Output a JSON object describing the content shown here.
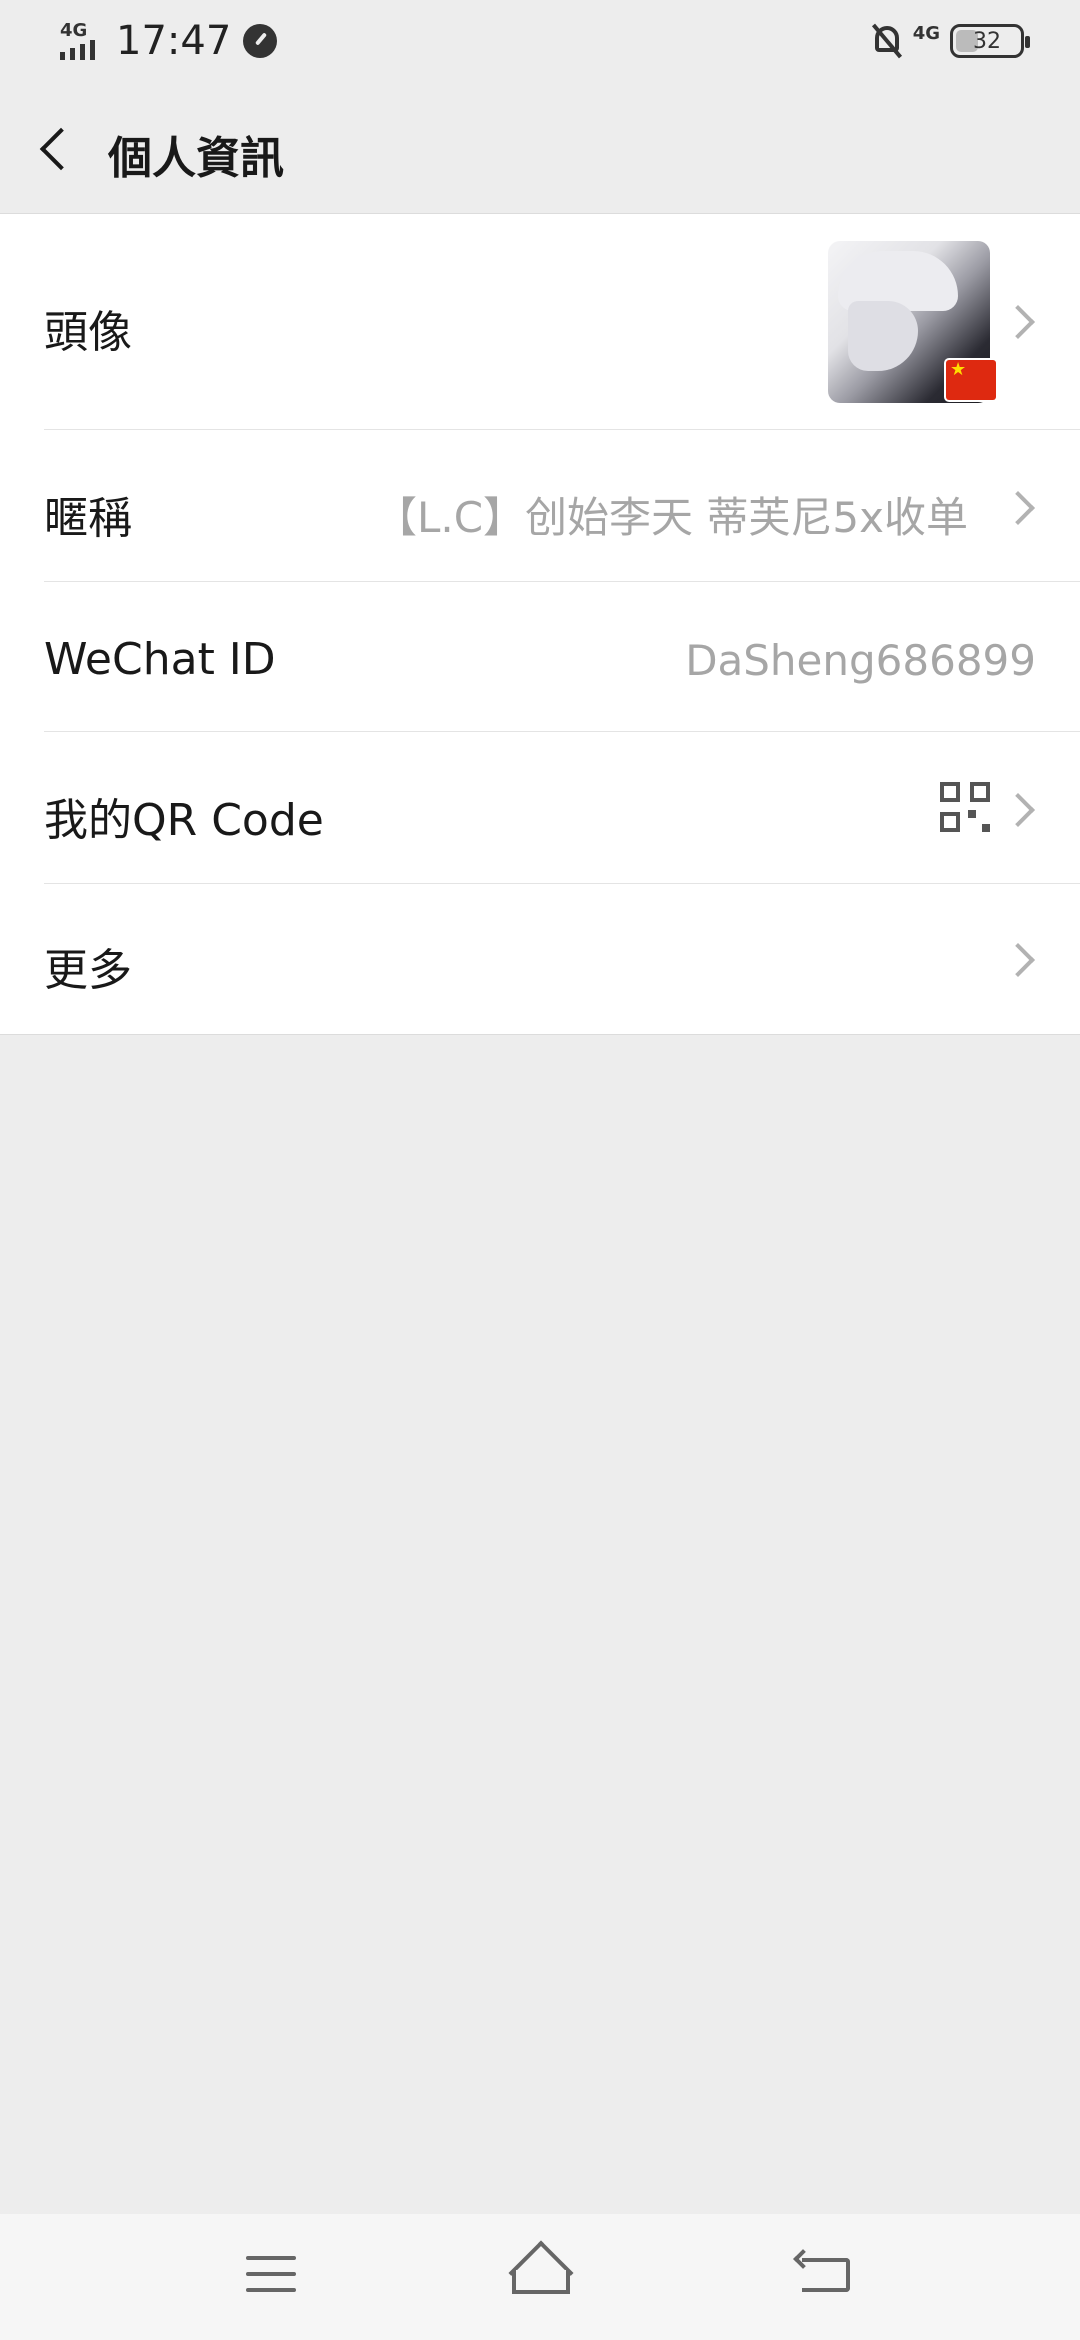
{
  "status_bar": {
    "network_left": "4G",
    "time": "17:47",
    "network_right": "4G",
    "battery": "32",
    "icons": [
      "signal-icon",
      "speedometer-icon",
      "bell-off-icon",
      "battery-icon"
    ]
  },
  "nav": {
    "title": "個人資訊",
    "back_icon": "chevron-left-icon"
  },
  "profile": {
    "rows": [
      {
        "label": "頭像",
        "value": "",
        "has_arrow": true,
        "extra": "avatar"
      },
      {
        "label": "暱稱",
        "value": "【L.C】创始李天 蒂芙尼5x收单",
        "has_arrow": true
      },
      {
        "label": "WeChat ID",
        "value": "DaSheng686899",
        "has_arrow": false
      },
      {
        "label": "我的QR Code",
        "value": "",
        "has_arrow": true,
        "extra": "qr-code-icon"
      },
      {
        "label": "更多",
        "value": "",
        "has_arrow": true
      }
    ]
  },
  "system_nav": {
    "icons": [
      "menu-icon",
      "home-icon",
      "return-icon"
    ]
  },
  "colors": {
    "background": "#ededed",
    "row_background": "#ffffff",
    "value_text": "#a6a6a6",
    "flag_red": "#de2910"
  }
}
